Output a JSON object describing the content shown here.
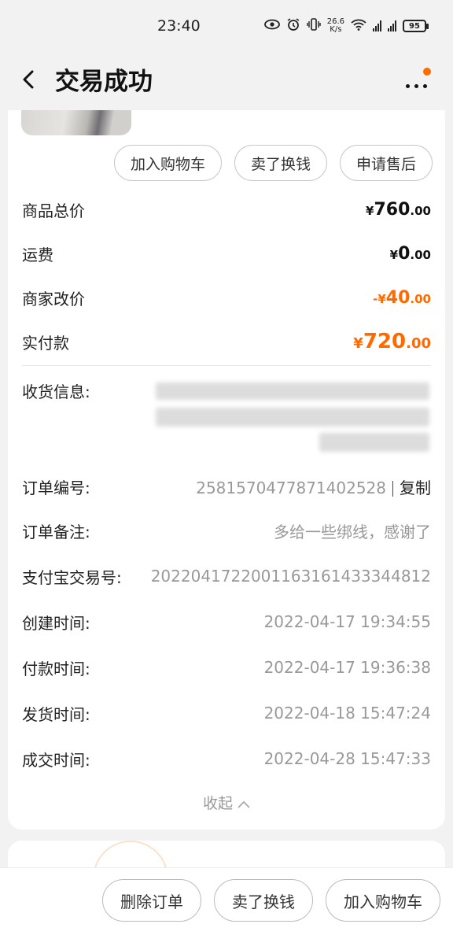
{
  "status_bar": {
    "time": "23:40",
    "net_speed_value": "26.6",
    "net_speed_unit": "K/s",
    "net_type": "4G",
    "battery": "95"
  },
  "nav": {
    "title": "交易成功"
  },
  "actions": [
    "加入购物车",
    "卖了换钱",
    "申请售后"
  ],
  "prices": [
    {
      "label": "商品总价",
      "currency": "¥",
      "int": "760",
      "dec": ".00",
      "style": "normal"
    },
    {
      "label": "运费",
      "currency": "¥",
      "int": "0",
      "dec": ".00",
      "style": "normal"
    },
    {
      "label": "商家改价",
      "currency": "-¥",
      "int": "40",
      "dec": ".00",
      "style": "orange"
    },
    {
      "label": "实付款",
      "currency": "¥",
      "int": "720",
      "dec": ".00",
      "style": "orange-big"
    }
  ],
  "shipping": {
    "label": "收货信息:"
  },
  "order": {
    "number_label": "订单编号:",
    "number_value": "2581570477871402528",
    "copy_label": "复制",
    "note_label": "订单备注:",
    "note_value": "多给一些绑线，感谢了",
    "alipay_label": "支付宝交易号:",
    "alipay_value": "2022041722001163161433344812",
    "created_label": "创建时间:",
    "created_value": "2022-04-17 19:34:55",
    "paid_label": "付款时间:",
    "paid_value": "2022-04-17 19:36:38",
    "shipped_label": "发货时间:",
    "shipped_value": "2022-04-18 15:47:24",
    "closed_label": "成交时间:",
    "closed_value": "2022-04-28 15:47:33"
  },
  "collapse_label": "收起",
  "bottom": [
    "删除订单",
    "卖了换钱",
    "加入购物车"
  ],
  "colors": {
    "accent": "#ff6a00",
    "background": "#f2f2f2"
  }
}
